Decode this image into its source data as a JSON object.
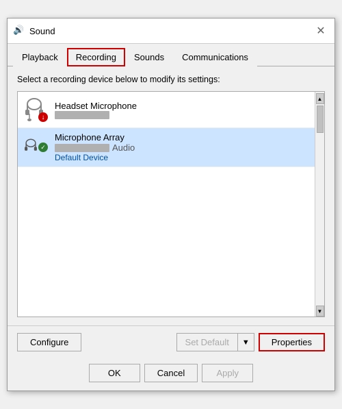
{
  "window": {
    "title": "Sound",
    "icon": "🔊"
  },
  "tabs": [
    {
      "label": "Playback",
      "active": false
    },
    {
      "label": "Recording",
      "active": true
    },
    {
      "label": "Sounds",
      "active": false
    },
    {
      "label": "Communications",
      "active": false
    }
  ],
  "description": "Select a recording device below to modify its settings:",
  "devices": [
    {
      "name": "Headset Microphone",
      "sub": "",
      "status": "disabled",
      "selected": false
    },
    {
      "name": "Microphone Array",
      "sub": "Audio",
      "status_label": "Default Device",
      "selected": true
    }
  ],
  "buttons": {
    "configure": "Configure",
    "set_default": "Set Default",
    "properties": "Properties",
    "ok": "OK",
    "cancel": "Cancel",
    "apply": "Apply"
  }
}
